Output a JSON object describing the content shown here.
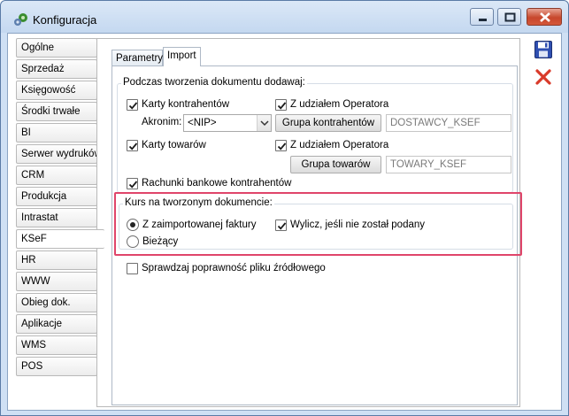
{
  "window": {
    "title": "Konfiguracja",
    "icon": "gear-icon",
    "controls": [
      "minimize-icon",
      "maximize-icon",
      "close-icon"
    ]
  },
  "nav": {
    "items": [
      {
        "label": "Ogólne"
      },
      {
        "label": "Sprzedaż"
      },
      {
        "label": "Księgowość"
      },
      {
        "label": "Środki trwałe"
      },
      {
        "label": "BI"
      },
      {
        "label": "Serwer wydruków"
      },
      {
        "label": "CRM"
      },
      {
        "label": "Produkcja"
      },
      {
        "label": "Intrastat"
      },
      {
        "label": "KSeF",
        "active": true
      },
      {
        "label": "HR"
      },
      {
        "label": "WWW"
      },
      {
        "label": "Obieg dok."
      },
      {
        "label": "Aplikacje"
      },
      {
        "label": "WMS"
      },
      {
        "label": "POS"
      }
    ]
  },
  "tabs": [
    {
      "label": "Parametry"
    },
    {
      "label": "Import",
      "active": true
    }
  ],
  "import": {
    "group_title": "Podczas tworzenia dokumentu dodawaj:",
    "karty_kontrahentow": {
      "label": "Karty kontrahentów",
      "checked": true
    },
    "akronim_label": "Akronim:",
    "akronim_value": "<NIP>",
    "kontrahenci_operator": {
      "label": "Z udziałem Operatora",
      "checked": true
    },
    "grupa_kontrahentow_button": "Grupa kontrahentów",
    "grupa_kontrahentow_value": "DOSTAWCY_KSEF",
    "karty_towarow": {
      "label": "Karty towarów",
      "checked": true
    },
    "towary_operator": {
      "label": "Z udziałem Operatora",
      "checked": true
    },
    "grupa_towarow_button": "Grupa towarów",
    "grupa_towarow_value": "TOWARY_KSEF",
    "rachunki": {
      "label": "Rachunki bankowe kontrahentów",
      "checked": true
    },
    "kurs_group_title": "Kurs na tworzonym dokumencie:",
    "kurs_z_faktury": {
      "label": "Z zaimportowanej faktury",
      "selected": true
    },
    "kurs_biezacy": {
      "label": "Bieżący",
      "selected": false
    },
    "wylicz": {
      "label": "Wylicz, jeśli nie został podany",
      "checked": true
    },
    "sprawdzaj": {
      "label": "Sprawdzaj poprawność pliku źródłowego",
      "checked": false
    }
  },
  "toolbar": {
    "save_icon": "save-icon",
    "cancel_icon": "cancel-icon"
  },
  "colors": {
    "highlight": "#e0456a",
    "close_button": "#c7472c",
    "titlebar": "#c4d8f0"
  }
}
